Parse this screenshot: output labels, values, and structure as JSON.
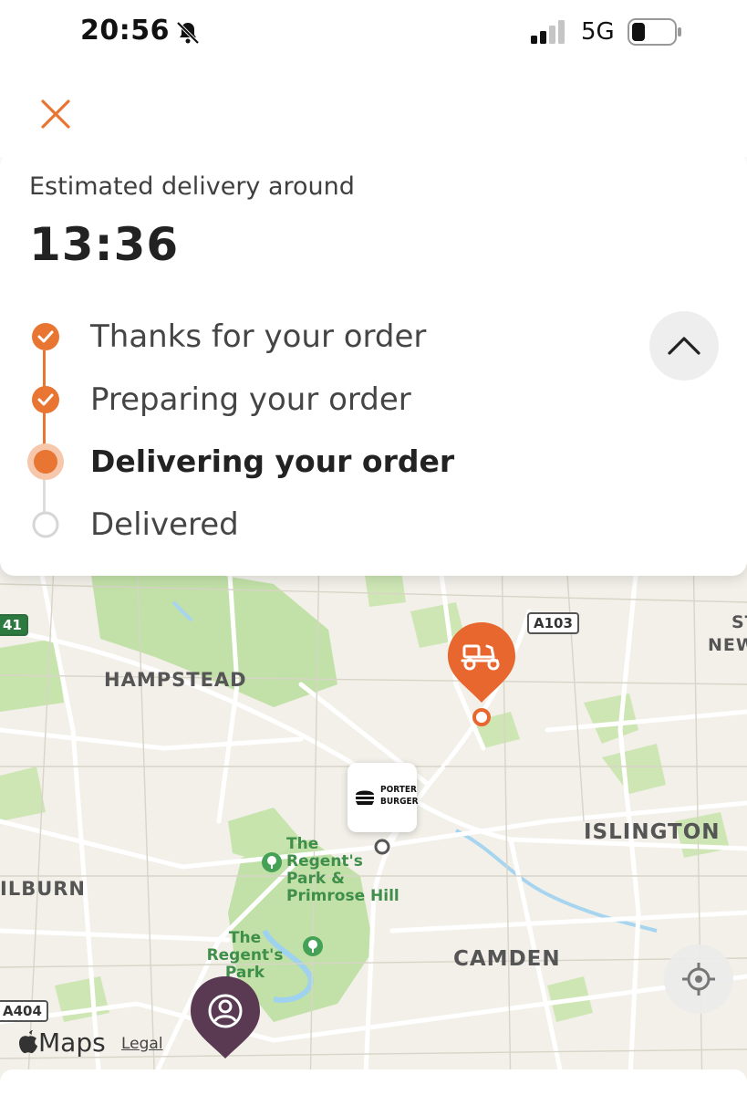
{
  "status_bar": {
    "time": "20:56",
    "network": "5G",
    "icons": [
      "bell-slash-icon",
      "signal-icon",
      "battery-icon"
    ]
  },
  "header": {
    "close_icon": "close-icon"
  },
  "eta": {
    "label": "Estimated delivery around",
    "time": "13:36"
  },
  "progress": {
    "steps": [
      {
        "label": "Thanks for your order",
        "state": "done"
      },
      {
        "label": "Preparing your order",
        "state": "done"
      },
      {
        "label": "Delivering your order",
        "state": "active"
      },
      {
        "label": "Delivered",
        "state": "pending"
      }
    ],
    "collapse_icon": "chevron-up-icon"
  },
  "map": {
    "area_labels": [
      "HAMPSTEAD",
      "ISLINGTON",
      "CAMDEN",
      "ILBURN",
      "ST",
      "NEW"
    ],
    "park_labels": [
      "The Regent's Park & Primrose Hill",
      "The Regent's Park"
    ],
    "road_shields": [
      "A103",
      "A404",
      "41"
    ],
    "store_brand": [
      "PORTER",
      "BURGER"
    ],
    "attribution": "Maps",
    "legal": "Legal"
  },
  "colors": {
    "accent": "#e87532",
    "destination_pin": "#5a3a52",
    "park": "#bfe0a3"
  }
}
